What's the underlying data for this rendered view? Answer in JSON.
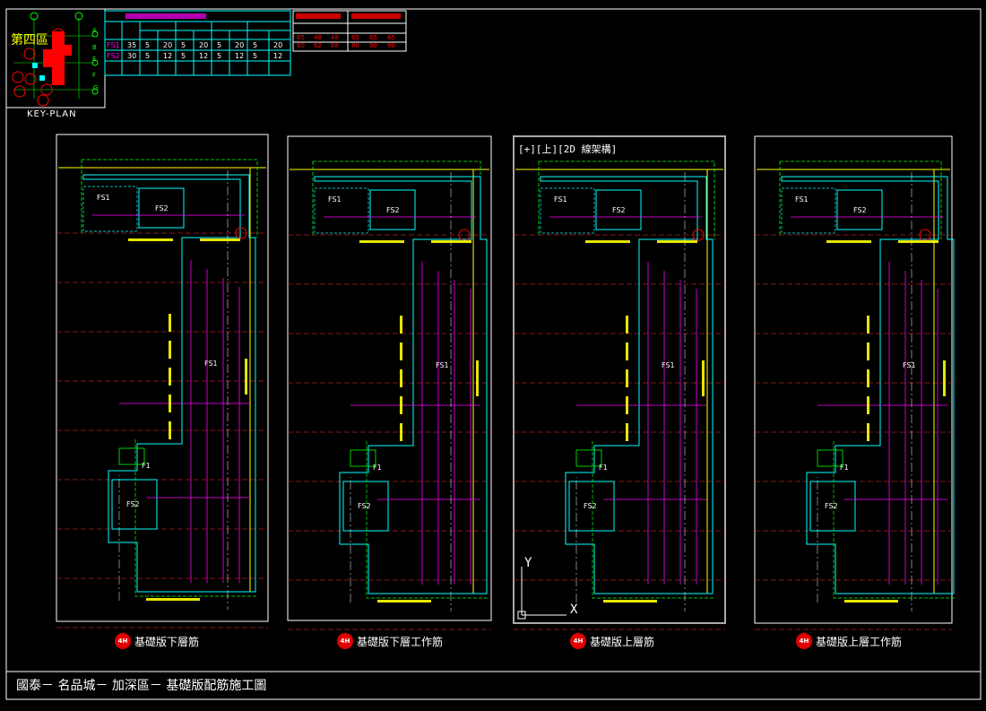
{
  "drawing_title": "國泰－ 名品城－ 加深區－ 基礎版配筋施工圖",
  "key_plan": {
    "label": "KEY-PLAN",
    "area": "第四區",
    "markers": [
      "4G",
      "4F",
      "4C",
      "4D",
      "4B",
      "4A",
      "4H",
      "4E"
    ],
    "grid_letters": [
      "A",
      "B",
      "E",
      "F",
      "G",
      "H",
      "K"
    ]
  },
  "viewport_label": "[+][上][2D 線架構]",
  "table_main": {
    "rows": [
      {
        "name": "FS1",
        "values": [
          "35",
          "5",
          "20",
          "5",
          "20",
          "5",
          "20",
          "5",
          "20"
        ]
      },
      {
        "name": "FS2",
        "values": [
          "30",
          "5",
          "12",
          "5",
          "12",
          "5",
          "12",
          "5",
          "12"
        ]
      }
    ]
  },
  "table_right": {
    "row1": [
      "65",
      "48",
      "48",
      "65",
      "65",
      "65"
    ],
    "row2": [
      "60",
      "62",
      "68",
      "60",
      "90",
      "90"
    ]
  },
  "panels": [
    {
      "caption_tag": "4H",
      "caption": "基礎版下層筋"
    },
    {
      "caption_tag": "4H",
      "caption": "基礎版下層工作筋"
    },
    {
      "caption_tag": "4H",
      "caption": "基礎版上層筋"
    },
    {
      "caption_tag": "4H",
      "caption": "基礎版上層工作筋"
    }
  ],
  "room_labels": [
    "FS1",
    "FS2",
    "F1"
  ],
  "colors": {
    "background": "#000000",
    "frame": "#ffffff",
    "cyan": "#00ffff",
    "green": "#00ff00",
    "yellow": "#ffff00",
    "magenta": "#ff00ff",
    "red": "#ff0000",
    "axis": "#ffffff"
  }
}
